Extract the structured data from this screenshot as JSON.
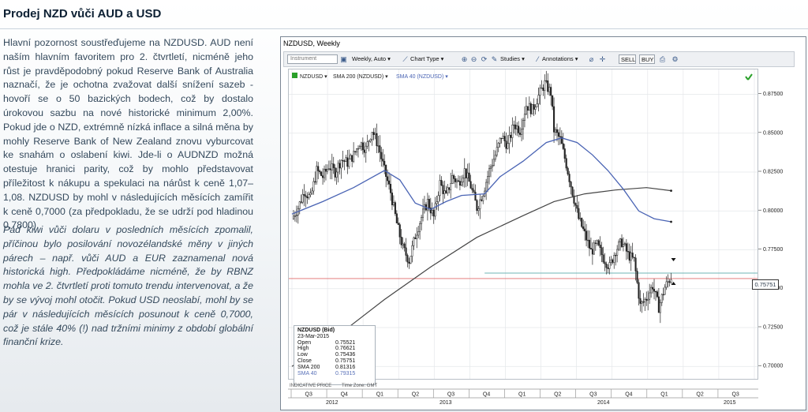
{
  "heading": "Prodej NZD vůči AUD a USD",
  "paragraph1": "Hlavní pozornost soustřeďujeme na NZDUSD. AUD není naším hlavním favoritem pro 2. čtvrtletí, nicméně jeho růst je pravděpodobný pokud Reserve Bank of Australia naznačí, že je ochotna zvažovat další snížení sazeb - hovoří se o 50 bazických bodech, což by dostalo úrokovou sazbu na nové historické minimum 2,00%. Pokud jde o NZD, extrémně nízká inflace a silná měna by mohly Reserve Bank of New Zealand znovu vyburcovat ke snahám o oslabení kiwi. Jde-li o AUDNZD možná otestuje hranici parity, což by mohlo představovat příležitost k nákupu a spekulaci na nárůst k ceně 1,07–1,08. NZDUSD by mohl v následujících měsících zamířit k ceně 0,7000 (za předpokladu, že se udrží pod hladinou 0,7800).",
  "paragraph2": "Pád kiwi vůči dolaru v posledních měsících zpomalil, příčinou bylo posilování novozélandské měny v jiných párech – např. vůči AUD a EUR zaznamenal nová historická high. Předpokládáme nicméně, že by RBNZ mohla ve 2. čtvrtletí proti tomuto trendu intervenovat, a že by se vývoj mohl otočit. Pokud USD neoslabí, mohl by se pár v následujících měsících posunout k ceně 0,7000, což je stále 40% (!) nad tržními minimy z období globální finanční krize.",
  "chart_window": {
    "title": "NZDUSD, Weekly",
    "toolbar": {
      "instrument_placeholder": "Instrument",
      "period": "Weekly, Auto",
      "chart_type": "Chart Type",
      "studies": "Studies",
      "annotations": "Annotations",
      "sell": "SELL",
      "buy": "BUY"
    },
    "legend": [
      "NZDUSD",
      "SMA 200 (NZDUSD)",
      "SMA 40 (NZDUSD)"
    ],
    "info_box": {
      "title": "NZDUSD (Bid)",
      "date": "23-Mar-2015",
      "rows": [
        {
          "label": "Open",
          "value": "0.75521"
        },
        {
          "label": "High",
          "value": "0.76621"
        },
        {
          "label": "Low",
          "value": "0.75436"
        },
        {
          "label": "Close",
          "value": "0.75751"
        },
        {
          "label": "SMA 200",
          "value": "0.81316"
        },
        {
          "label": "SMA 40",
          "value": "0.79315"
        }
      ]
    },
    "current_price": "0.75751",
    "footer_left": "INDICATIVE PRICE",
    "footer_tz": "Time Zone: GMT",
    "colors": {
      "sma200": "#444444",
      "sma40": "#4a64b4",
      "candle": "#222222",
      "ref_red": "#e06b6b",
      "ref_teal": "#6fb6b6"
    }
  },
  "chart_data": {
    "type": "candlestick",
    "ylim": [
      0.692,
      0.891
    ],
    "y_ticks": [
      "0.87500",
      "0.85000",
      "0.82500",
      "0.80000",
      "0.77500",
      "0.75000",
      "0.72500",
      "0.70000"
    ],
    "quarters": [
      "Q3",
      "Q4",
      "Q1",
      "Q2",
      "Q3",
      "Q4",
      "Q1",
      "Q2",
      "Q3",
      "Q4",
      "Q1",
      "Q2",
      "Q3"
    ],
    "years": [
      "2012",
      "2013",
      "2014",
      "2015"
    ],
    "close_path": [
      [
        0,
        0.795
      ],
      [
        4,
        0.802
      ],
      [
        8,
        0.813
      ],
      [
        12,
        0.808
      ],
      [
        16,
        0.826
      ],
      [
        20,
        0.822
      ],
      [
        24,
        0.829
      ],
      [
        28,
        0.825
      ],
      [
        32,
        0.833
      ],
      [
        36,
        0.831
      ],
      [
        40,
        0.836
      ],
      [
        44,
        0.844
      ],
      [
        48,
        0.84
      ],
      [
        52,
        0.852
      ],
      [
        56,
        0.842
      ],
      [
        60,
        0.826
      ],
      [
        64,
        0.812
      ],
      [
        68,
        0.792
      ],
      [
        72,
        0.776
      ],
      [
        76,
        0.768
      ],
      [
        80,
        0.784
      ],
      [
        84,
        0.796
      ],
      [
        88,
        0.806
      ],
      [
        92,
        0.796
      ],
      [
        96,
        0.818
      ],
      [
        100,
        0.809
      ],
      [
        104,
        0.822
      ],
      [
        108,
        0.818
      ],
      [
        112,
        0.826
      ],
      [
        116,
        0.816
      ],
      [
        120,
        0.802
      ],
      [
        124,
        0.812
      ],
      [
        128,
        0.826
      ],
      [
        132,
        0.836
      ],
      [
        136,
        0.848
      ],
      [
        140,
        0.842
      ],
      [
        144,
        0.856
      ],
      [
        148,
        0.852
      ],
      [
        152,
        0.868
      ],
      [
        156,
        0.865
      ],
      [
        160,
        0.874
      ],
      [
        164,
        0.882
      ],
      [
        168,
        0.876
      ],
      [
        170,
        0.852
      ],
      [
        174,
        0.846
      ],
      [
        178,
        0.83
      ],
      [
        182,
        0.812
      ],
      [
        186,
        0.795
      ],
      [
        190,
        0.785
      ],
      [
        194,
        0.774
      ],
      [
        198,
        0.778
      ],
      [
        202,
        0.77
      ],
      [
        206,
        0.764
      ],
      [
        210,
        0.775
      ],
      [
        214,
        0.78
      ],
      [
        218,
        0.772
      ],
      [
        222,
        0.768
      ],
      [
        226,
        0.739
      ],
      [
        230,
        0.744
      ],
      [
        234,
        0.752
      ],
      [
        238,
        0.738
      ],
      [
        242,
        0.751
      ],
      [
        246,
        0.7575
      ]
    ],
    "sma200": [
      [
        0,
        0.7
      ],
      [
        30,
        0.72
      ],
      [
        60,
        0.743
      ],
      [
        90,
        0.764
      ],
      [
        120,
        0.783
      ],
      [
        150,
        0.797
      ],
      [
        170,
        0.806
      ],
      [
        190,
        0.811
      ],
      [
        210,
        0.8135
      ],
      [
        230,
        0.815
      ],
      [
        246,
        0.813
      ]
    ],
    "sma40": [
      [
        0,
        0.798
      ],
      [
        20,
        0.806
      ],
      [
        40,
        0.815
      ],
      [
        60,
        0.826
      ],
      [
        70,
        0.82
      ],
      [
        80,
        0.805
      ],
      [
        90,
        0.801
      ],
      [
        100,
        0.806
      ],
      [
        110,
        0.81
      ],
      [
        125,
        0.811
      ],
      [
        135,
        0.822
      ],
      [
        150,
        0.832
      ],
      [
        165,
        0.844
      ],
      [
        175,
        0.847
      ],
      [
        185,
        0.844
      ],
      [
        195,
        0.836
      ],
      [
        205,
        0.826
      ],
      [
        215,
        0.814
      ],
      [
        225,
        0.8
      ],
      [
        235,
        0.795
      ],
      [
        246,
        0.793
      ]
    ],
    "ref_lines": {
      "teal": 0.76,
      "red": 0.7565
    }
  }
}
